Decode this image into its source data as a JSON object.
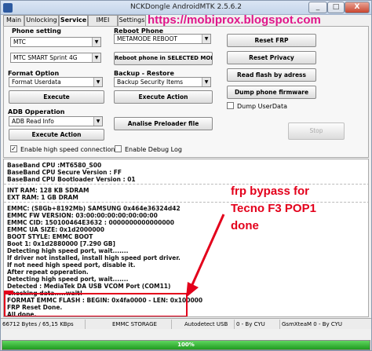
{
  "window": {
    "title": "NCKDongle AndroidMTK 2.5.6.2",
    "minimize": "_",
    "maximize": "□",
    "close": "X"
  },
  "tabs": [
    {
      "label": "Main",
      "active": false
    },
    {
      "label": "Unlocking",
      "active": false
    },
    {
      "label": "Service",
      "active": true
    },
    {
      "label": "IMEI Utils",
      "active": false
    },
    {
      "label": "Settings",
      "active": false
    }
  ],
  "watermark": "https://mobiprox.blogspot.com",
  "phone_setting": {
    "label": "Phone setting",
    "brand": "MTC",
    "model": "MTC SMART Sprint 4G"
  },
  "format_option": {
    "label": "Format Option",
    "value": "Format Userdata",
    "execute": "Execute"
  },
  "adb_operation": {
    "label": "ADB Opperation",
    "value": "ADB Read Info",
    "execute": "Execute Action"
  },
  "reboot_phone": {
    "label": "Reboot Phone",
    "value": "METAMODE REBOOT",
    "button": "Reboot phone in SELECTED MODE"
  },
  "backup_restore": {
    "label": "Backup - Restore",
    "value": "Backup Security Items",
    "execute": "Execute Action"
  },
  "analise_button": "Analise Preloader file",
  "right_buttons": {
    "reset_frp": "Reset FRP",
    "reset_privacy": "Reset Privacy",
    "read_flash": "Read flash by adress",
    "dump_firmware": "Dump phone firmware",
    "dump_userdata": "Dump UserData",
    "stop": "Stop"
  },
  "options": {
    "high_speed": "Enable high speed connection",
    "high_speed_checked": true,
    "debug_log": "Enable Debug Log",
    "debug_log_checked": false
  },
  "log": [
    "BaseBand CPU :MT6580_S00",
    "BaseBand CPU Secure Version : FF",
    "BaseBand CPU Bootloader Version : 01",
    "INT RAM: 128 KB SDRAM",
    "EXT RAM: 1 GB  DRAM",
    "EMMC: (S8Gb+8192Mb) SAMSUNG 0x464e36324d42",
    "EMMC FW VERSION: 03:00:00:00:00:00:00:00",
    "EMMC CID: 150100464E3632 : 0000000000000000",
    "EMMC UA SIZE: 0x1d2000000",
    "BOOT STYLE: EMMC BOOT",
    "Boot 1: 0x1d2880000           [7.290 GB]",
    "Detecting high speed port, wait.......",
    "If driver not installed, install high speed port driver.",
    "If not need high speed port, disable it.",
    "After repeat opperation.",
    "Detecting high speed port, wait.......",
    "Detected : MediaTek DA USB VCOM Port (COM11)",
    "Checking data.....wait!",
    "FORMAT EMMC FLASH :  BEGIN: 0x4fa0000       - LEN: 0x100000",
    "FRP Reset Done.",
    "All done."
  ],
  "overlay_text": [
    "frp bypass for",
    "Tecno F3 POP1",
    "done"
  ],
  "status_bar": [
    "66712 Bytes / 65,15 KBps",
    "EMMC STORAGE",
    "Autodetect USB",
    "0 - By CYU",
    "GsmXteaM 0 - By CYU"
  ],
  "progress": {
    "fraction": 1.0,
    "label": "100%"
  },
  "colors": {
    "overlay": "#e3001b",
    "watermark": "#e0168a",
    "progress": "#1f9a1f"
  }
}
